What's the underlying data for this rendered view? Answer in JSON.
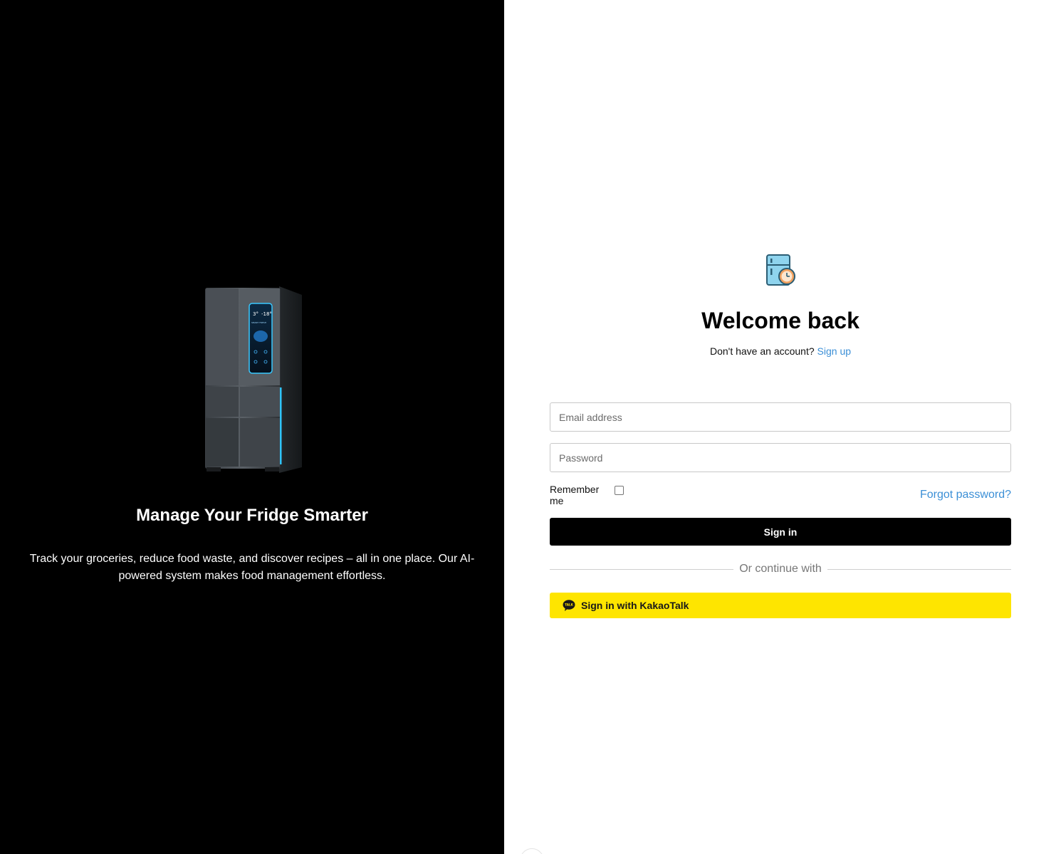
{
  "left_panel": {
    "title": "Manage Your Fridge Smarter",
    "description": "Track your groceries, reduce food waste, and discover recipes – all in one place. Our AI-powered system makes food management effortless.",
    "fridge_display": {
      "fridge_temp": "3°",
      "freezer_temp": "-18°",
      "mode": "SMART FRESH"
    }
  },
  "login": {
    "title": "Welcome back",
    "signup_prompt": "Don't have an account?",
    "signup_link": "Sign up",
    "email_placeholder": "Email address",
    "password_placeholder": "Password",
    "remember_label": "Remember me",
    "forgot_label": "Forgot password?",
    "signin_label": "Sign in",
    "divider_label": "Or continue with",
    "kakao_label": "Sign in with KakaoTalk",
    "kakao_icon_text": "TALK"
  },
  "colors": {
    "left_bg": "#000000",
    "link": "#3b8fd6",
    "primary_button": "#000000",
    "kakao_yellow": "#fee500"
  }
}
